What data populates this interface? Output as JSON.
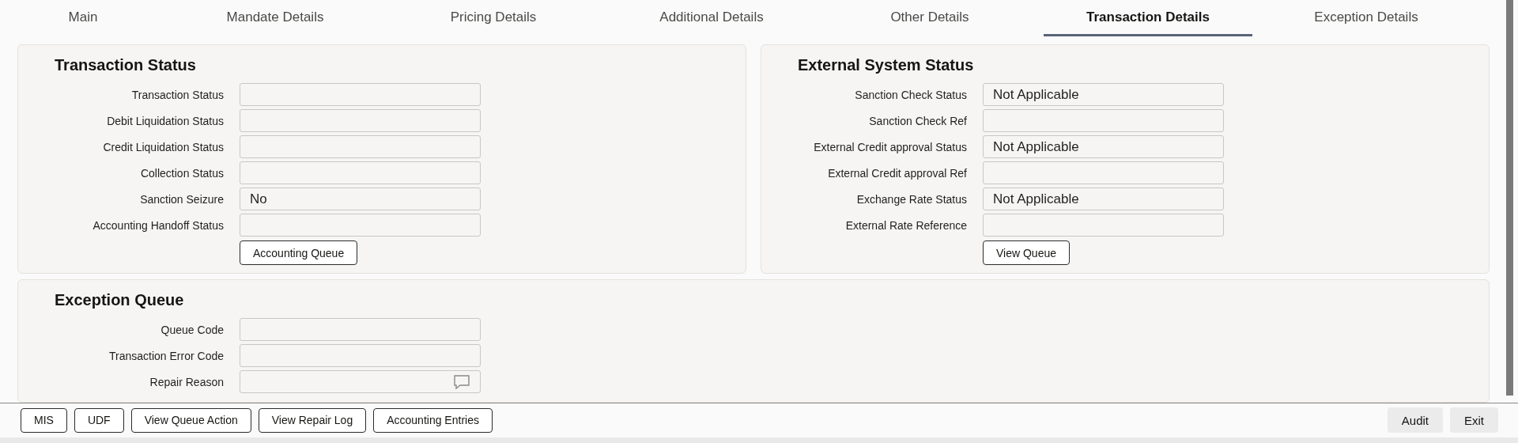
{
  "tabs": [
    {
      "label": "Main",
      "selected": false
    },
    {
      "label": "Mandate Details",
      "selected": false
    },
    {
      "label": "Pricing Details",
      "selected": false
    },
    {
      "label": "Additional Details",
      "selected": false
    },
    {
      "label": "Other Details",
      "selected": false
    },
    {
      "label": "Transaction Details",
      "selected": true
    },
    {
      "label": "Exception Details",
      "selected": false
    }
  ],
  "transaction_status": {
    "title": "Transaction Status",
    "fields": [
      {
        "label": "Transaction Status"
      },
      {
        "label": "Debit Liquidation Status"
      },
      {
        "label": "Credit Liquidation Status"
      },
      {
        "label": "Collection Status"
      },
      {
        "label": "Sanction Seizure",
        "value": "No"
      },
      {
        "label": "Accounting Handoff Status"
      }
    ],
    "button": "Accounting Queue"
  },
  "external_system_status": {
    "title": "External System Status",
    "fields": [
      {
        "label": "Sanction Check Status",
        "value": "Not Applicable"
      },
      {
        "label": "Sanction Check Ref"
      },
      {
        "label": "External Credit approval Status",
        "value": "Not Applicable"
      },
      {
        "label": "External Credit approval Ref"
      },
      {
        "label": "Exchange Rate Status",
        "value": "Not Applicable"
      },
      {
        "label": "External Rate Reference"
      }
    ],
    "button": "View Queue"
  },
  "exception_queue": {
    "title": "Exception Queue",
    "fields": [
      {
        "label": "Queue Code",
        "kind": "text"
      },
      {
        "label": "Transaction Error Code",
        "kind": "text"
      },
      {
        "label": "Repair Reason",
        "kind": "comment"
      }
    ]
  },
  "footer": {
    "left_buttons": [
      "MIS",
      "UDF",
      "View Queue Action",
      "View Repair Log",
      "Accounting Entries"
    ],
    "right_buttons": [
      "Audit",
      "Exit"
    ]
  }
}
